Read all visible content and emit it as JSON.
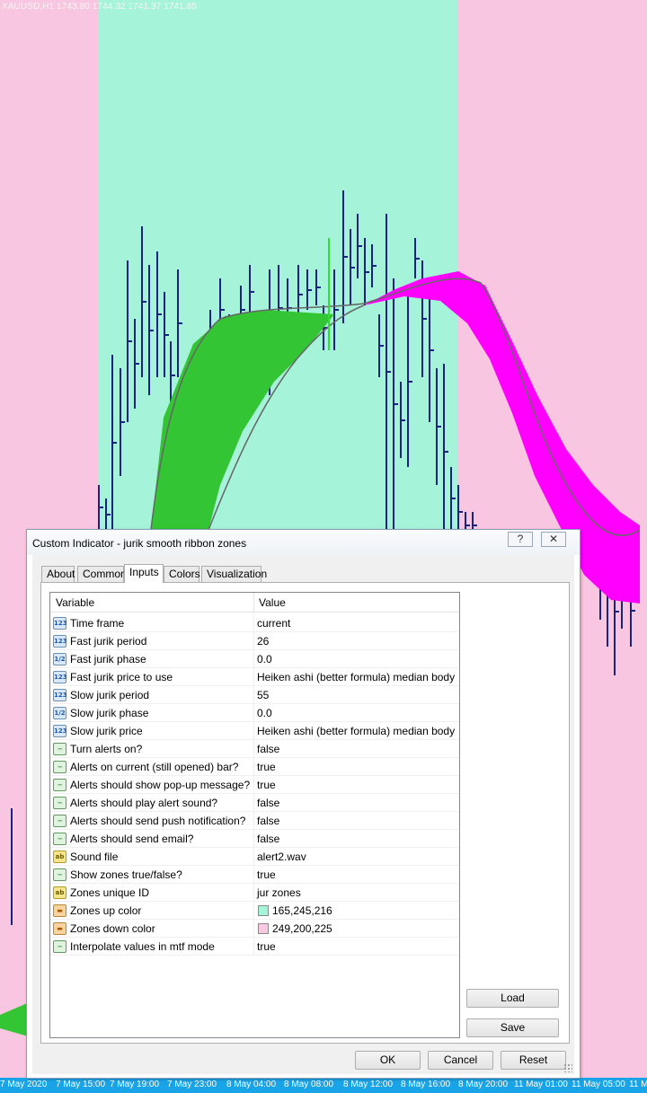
{
  "chart": {
    "header": "XAUUSD,H1  1743.80 1744.32 1741.37 1741.85",
    "zone_up_color": "#a5f3d9",
    "zone_down_color": "#f8c6e0",
    "time_labels": [
      "7 May 2020",
      "7 May 15:00",
      "7 May 19:00",
      "7 May 23:00",
      "8 May 04:00",
      "8 May 08:00",
      "8 May 12:00",
      "8 May 16:00",
      "8 May 20:00",
      "11 May 01:00",
      "11 May 05:00",
      "11 M"
    ]
  },
  "dialog": {
    "title": "Custom Indicator - jurik smooth ribbon zones",
    "help_button": "?",
    "close_button": "✕",
    "tabs": [
      "About",
      "Common",
      "Inputs",
      "Colors",
      "Visualization"
    ],
    "active_tab": "Inputs",
    "columns": {
      "variable": "Variable",
      "value": "Value"
    },
    "rows": [
      {
        "icon": "123",
        "type": "int",
        "variable": "Time frame",
        "value": "current"
      },
      {
        "icon": "123",
        "type": "int",
        "variable": "Fast jurik period",
        "value": "26"
      },
      {
        "icon": "1/2",
        "type": "dbl",
        "variable": "Fast jurik phase",
        "value": "0.0"
      },
      {
        "icon": "123",
        "type": "int",
        "variable": "Fast jurik price to use",
        "value": "Heiken ashi (better formula) median body"
      },
      {
        "icon": "123",
        "type": "int",
        "variable": "Slow jurik period",
        "value": "55"
      },
      {
        "icon": "1/2",
        "type": "dbl",
        "variable": "Slow jurik phase",
        "value": "0.0"
      },
      {
        "icon": "123",
        "type": "int",
        "variable": "Slow jurik price",
        "value": "Heiken ashi (better formula) median body"
      },
      {
        "icon": "~",
        "type": "bool",
        "variable": "Turn alerts on?",
        "value": "false"
      },
      {
        "icon": "~",
        "type": "bool",
        "variable": "Alerts on current (still opened) bar?",
        "value": "true"
      },
      {
        "icon": "~",
        "type": "bool",
        "variable": "Alerts should show pop-up message?",
        "value": "true"
      },
      {
        "icon": "~",
        "type": "bool",
        "variable": "Alerts should play alert sound?",
        "value": "false"
      },
      {
        "icon": "~",
        "type": "bool",
        "variable": "Alerts should send push notification?",
        "value": "false"
      },
      {
        "icon": "~",
        "type": "bool",
        "variable": "Alerts should send email?",
        "value": "false"
      },
      {
        "icon": "ab",
        "type": "str",
        "variable": "Sound file",
        "value": "alert2.wav"
      },
      {
        "icon": "~",
        "type": "bool",
        "variable": "Show zones true/false?",
        "value": "true"
      },
      {
        "icon": "ab",
        "type": "str",
        "variable": "Zones unique ID",
        "value": "jur zones"
      },
      {
        "icon": "▬",
        "type": "col",
        "variable": "Zones up color",
        "value": "165,245,216",
        "swatch": "#a5f5d8"
      },
      {
        "icon": "▬",
        "type": "col",
        "variable": "Zones down color",
        "value": "249,200,225",
        "swatch": "#f9c8e1"
      },
      {
        "icon": "~",
        "type": "bool",
        "variable": "Interpolate values in mtf mode",
        "value": "true"
      }
    ],
    "buttons": {
      "load": "Load",
      "save": "Save",
      "ok": "OK",
      "cancel": "Cancel",
      "reset": "Reset"
    }
  }
}
